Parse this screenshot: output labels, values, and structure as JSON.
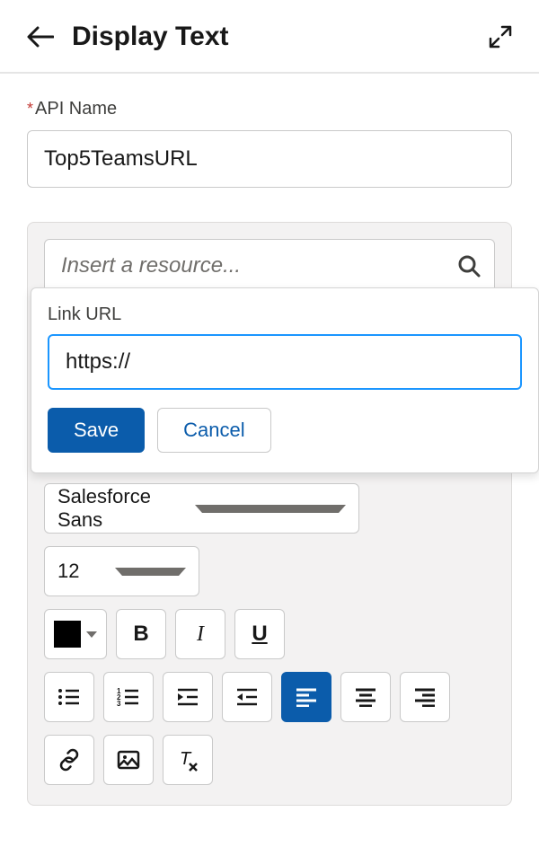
{
  "header": {
    "title": "Display Text"
  },
  "api_name": {
    "label": "API Name",
    "value": "Top5TeamsURL"
  },
  "editor": {
    "resource_placeholder": "Insert a resource...",
    "font_family": "Salesforce Sans",
    "font_size": "12"
  },
  "link_popover": {
    "label": "Link URL",
    "value": "https://",
    "save_label": "Save",
    "cancel_label": "Cancel"
  }
}
